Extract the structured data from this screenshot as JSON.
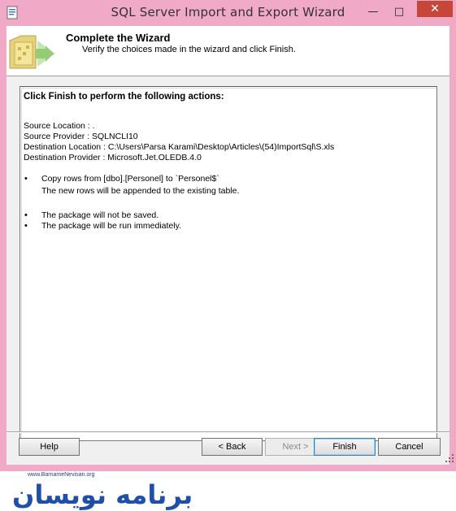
{
  "window": {
    "title": "SQL Server Import and Export Wizard",
    "minimize_glyph": "—",
    "maximize_glyph": "□",
    "close_glyph": "✕",
    "accent_color": "#f0a9c6",
    "close_color": "#c7463a"
  },
  "header": {
    "title": "Complete the Wizard",
    "subtitle": "Verify the choices made in the wizard and click Finish.",
    "icon": "wizard-folder-icon"
  },
  "summary": {
    "heading": "Click Finish to perform the following actions:",
    "details": [
      "Source Location : .",
      "Source Provider : SQLNCLI10",
      "Destination Location : C:\\Users\\Parsa Karami\\Desktop\\Articles\\(54)ImportSql\\S.xls",
      "Destination Provider : Microsoft.Jet.OLEDB.4.0"
    ],
    "bullet_glyph": "•",
    "action1": "Copy rows from [dbo].[Personel] to `Personel$`",
    "action1_note": "The new rows will be appended to the existing table.",
    "action2": "The package will not be saved.",
    "action3": "The package will be run immediately."
  },
  "buttons": {
    "help": "Help",
    "back": "< Back",
    "next": "Next >",
    "finish": "Finish",
    "cancel": "Cancel"
  },
  "watermark": {
    "url": "www.BarnameNevisan.org",
    "brand": "برنامه نویسان"
  }
}
